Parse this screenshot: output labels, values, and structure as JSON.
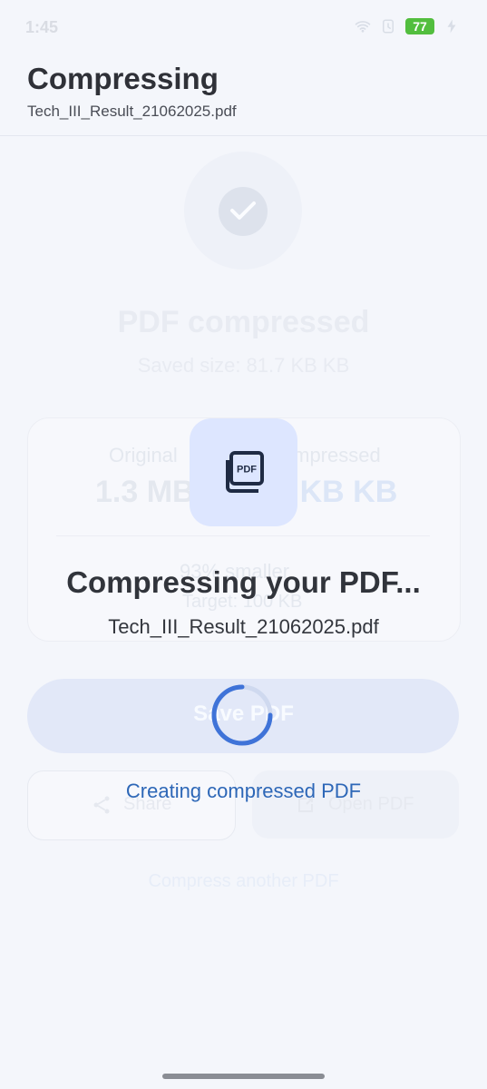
{
  "status": {
    "time": "1:45",
    "battery": "77"
  },
  "header": {
    "title": "Compressing",
    "subtitle": "Tech_III_Result_21062025.pdf"
  },
  "background_result": {
    "title": "PDF compressed",
    "subtitle": "Saved size: 81.7 KB KB",
    "original_label": "Original",
    "original_value": "1.3 MB",
    "compressed_label": "Compressed",
    "compressed_value": "81.7 KB KB",
    "smaller_text": "93% smaller",
    "target_text": "Target: 100 KB",
    "save_button_label": "Save PDF",
    "share_button_label": "Share",
    "open_button_label": "Open PDF",
    "another_button_label": "Compress another PDF"
  },
  "overlay": {
    "icon_label": "PDF",
    "title": "Compressing your PDF...",
    "filename": "Tech_III_Result_21062025.pdf",
    "status": "Creating compressed PDF"
  },
  "icons": {
    "wifi": "wifi-icon",
    "clock": "clock-icon",
    "charge": "charge-icon",
    "check": "check-icon",
    "pdf": "pdf-icon",
    "share": "share-icon",
    "open": "open-external-icon",
    "spinner": "spinner-icon"
  },
  "colors": {
    "background": "#f4f6fb",
    "accent": "#2d67b7",
    "badge": "#dde6ff",
    "spinner": "#3f73d8",
    "battery": "#52be3e"
  }
}
